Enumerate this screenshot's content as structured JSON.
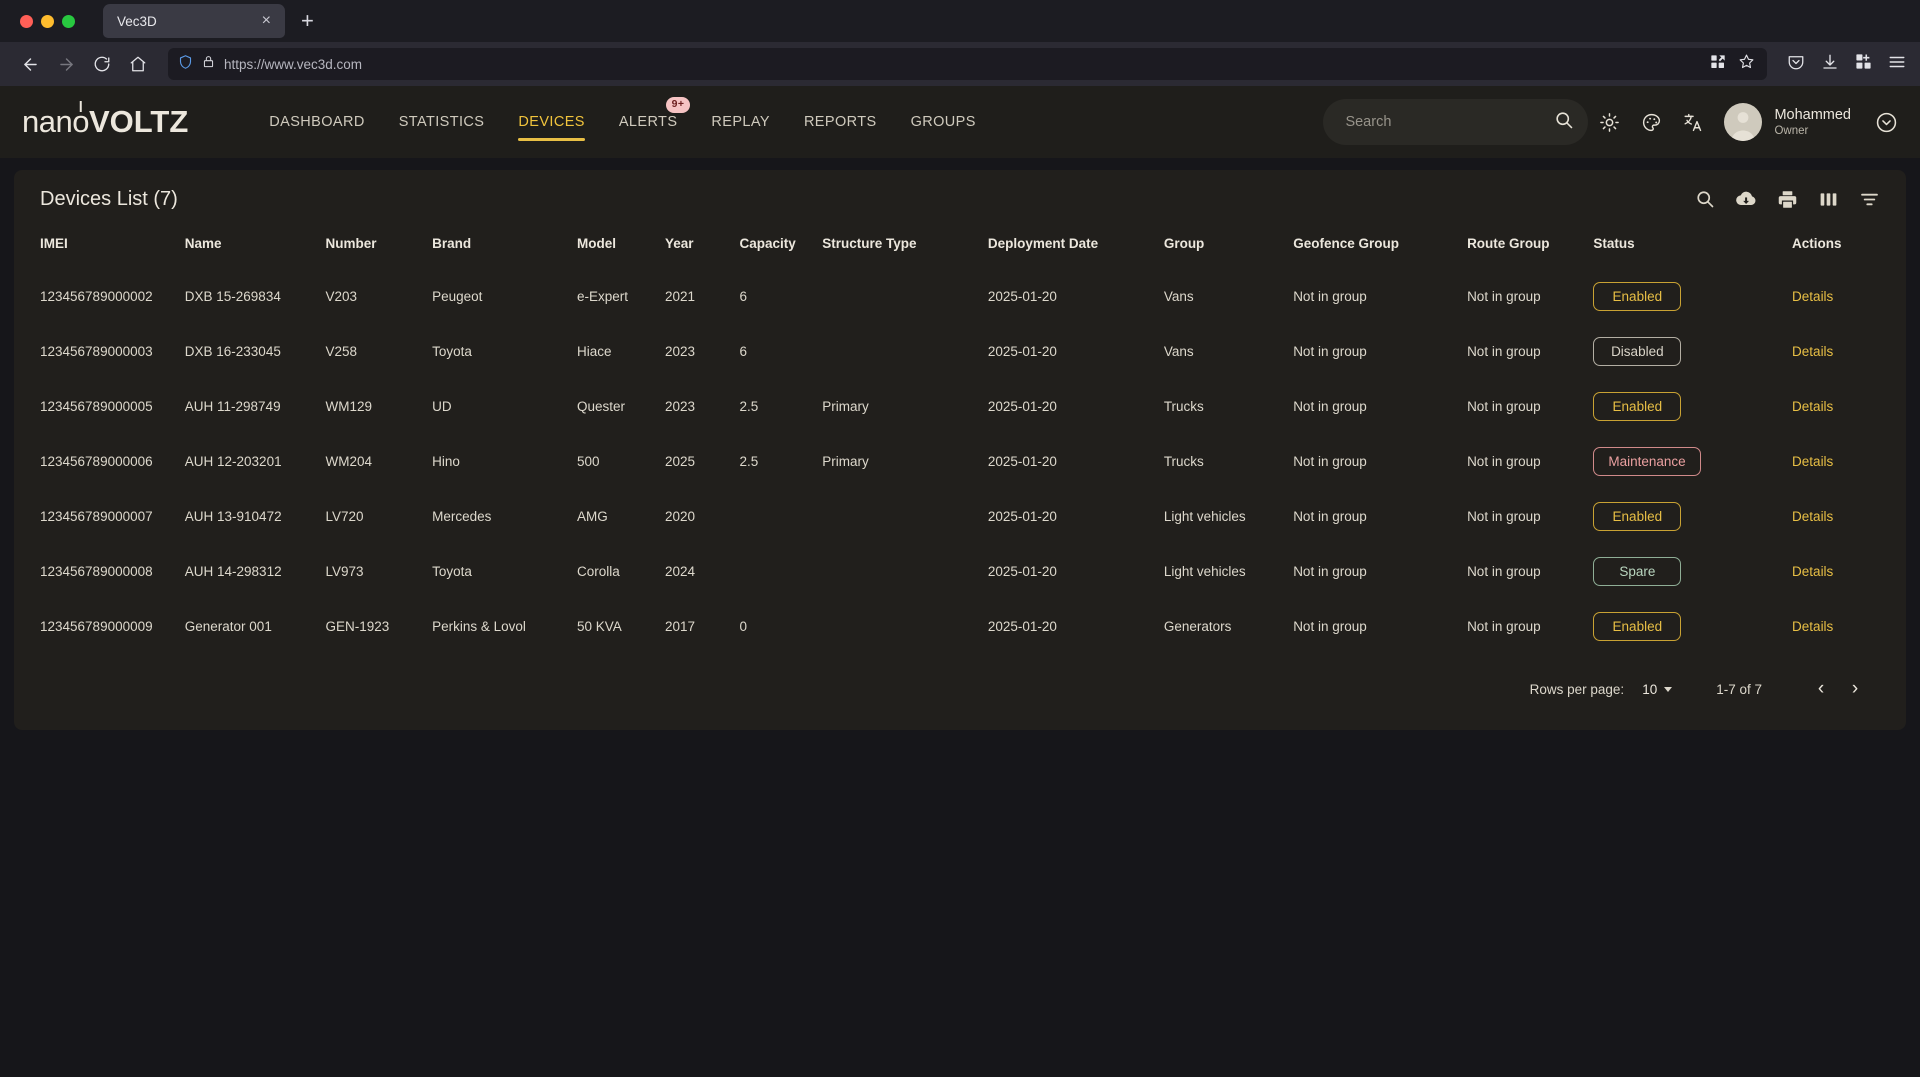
{
  "browser": {
    "tab_title": "Vec3D",
    "url": "https://www.vec3d.com",
    "new_tab_label": "+",
    "close_tab_label": "×"
  },
  "app_header": {
    "logo_light": "nan",
    "logo_power_o": "o",
    "logo_bold": "VOLTZ",
    "nav": [
      {
        "label": "DASHBOARD",
        "active": false,
        "badge": ""
      },
      {
        "label": "STATISTICS",
        "active": false,
        "badge": ""
      },
      {
        "label": "DEVICES",
        "active": true,
        "badge": ""
      },
      {
        "label": "ALERTS",
        "active": false,
        "badge": "9+"
      },
      {
        "label": "REPLAY",
        "active": false,
        "badge": ""
      },
      {
        "label": "REPORTS",
        "active": false,
        "badge": ""
      },
      {
        "label": "GROUPS",
        "active": false,
        "badge": ""
      }
    ],
    "search_placeholder": "Search",
    "search_value": "",
    "user_name": "Mohammed",
    "user_role": "Owner"
  },
  "card": {
    "title": "Devices List (7)",
    "columns": [
      "IMEI",
      "Name",
      "Number",
      "Brand",
      "Model",
      "Year",
      "Capacity",
      "Structure Type",
      "Deployment Date",
      "Group",
      "Geofence Group",
      "Route Group",
      "Status",
      "Actions"
    ],
    "rows": [
      {
        "imei": "123456789000002",
        "name": "DXB 15-269834",
        "number": "V203",
        "brand": "Peugeot",
        "model": "e-Expert",
        "year": "2021",
        "capacity": "6",
        "structure_type": "",
        "deployment_date": "2025-01-20",
        "group": "Vans",
        "geofence_group": "Not in group",
        "route_group": "Not in group",
        "status": "Enabled",
        "status_kind": "enabled",
        "action": "Details"
      },
      {
        "imei": "123456789000003",
        "name": "DXB 16-233045",
        "number": "V258",
        "brand": "Toyota",
        "model": "Hiace",
        "year": "2023",
        "capacity": "6",
        "structure_type": "",
        "deployment_date": "2025-01-20",
        "group": "Vans",
        "geofence_group": "Not in group",
        "route_group": "Not in group",
        "status": "Disabled",
        "status_kind": "disabled",
        "action": "Details"
      },
      {
        "imei": "123456789000005",
        "name": "AUH 11-298749",
        "number": "WM129",
        "brand": "UD",
        "model": "Quester",
        "year": "2023",
        "capacity": "2.5",
        "structure_type": "Primary",
        "deployment_date": "2025-01-20",
        "group": "Trucks",
        "geofence_group": "Not in group",
        "route_group": "Not in group",
        "status": "Enabled",
        "status_kind": "enabled",
        "action": "Details"
      },
      {
        "imei": "123456789000006",
        "name": "AUH 12-203201",
        "number": "WM204",
        "brand": "Hino",
        "model": "500",
        "year": "2025",
        "capacity": "2.5",
        "structure_type": "Primary",
        "deployment_date": "2025-01-20",
        "group": "Trucks",
        "geofence_group": "Not in group",
        "route_group": "Not in group",
        "status": "Maintenance",
        "status_kind": "maintenance",
        "action": "Details"
      },
      {
        "imei": "123456789000007",
        "name": "AUH 13-910472",
        "number": "LV720",
        "brand": "Mercedes",
        "model": "AMG",
        "year": "2020",
        "capacity": "",
        "structure_type": "",
        "deployment_date": "2025-01-20",
        "group": "Light vehicles",
        "geofence_group": "Not in group",
        "route_group": "Not in group",
        "status": "Enabled",
        "status_kind": "enabled",
        "action": "Details"
      },
      {
        "imei": "123456789000008",
        "name": "AUH 14-298312",
        "number": "LV973",
        "brand": "Toyota",
        "model": "Corolla",
        "year": "2024",
        "capacity": "",
        "structure_type": "",
        "deployment_date": "2025-01-20",
        "group": "Light vehicles",
        "geofence_group": "Not in group",
        "route_group": "Not in group",
        "status": "Spare",
        "status_kind": "spare",
        "action": "Details"
      },
      {
        "imei": "123456789000009",
        "name": "Generator 001",
        "number": "GEN-1923",
        "brand": "Perkins & Lovol",
        "model": "50 KVA",
        "year": "2017",
        "capacity": "0",
        "structure_type": "",
        "deployment_date": "2025-01-20",
        "group": "Generators",
        "geofence_group": "Not in group",
        "route_group": "Not in group",
        "status": "Enabled",
        "status_kind": "enabled",
        "action": "Details"
      }
    ]
  },
  "pagination": {
    "rows_per_page_label": "Rows per page:",
    "rows_per_page_value": "10",
    "range": "1-7 of 7",
    "prev_label": "‹",
    "next_label": "›"
  },
  "colors": {
    "accent_gold": "#e8bf45",
    "maintenance": "#eaa0a0",
    "spare": "#b9d6bf",
    "card_bg": "#211f1c",
    "header_bg": "#1f1e1b",
    "page_bg": "#16161a"
  }
}
